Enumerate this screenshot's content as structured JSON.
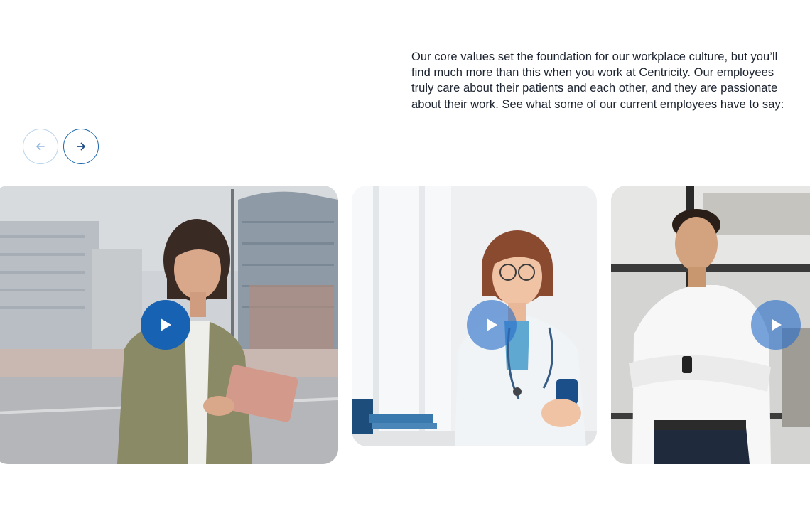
{
  "intro": {
    "text": "Our core values set the foundation for our workplace culture, but you’ll find much more than this when you work at Centricity. Our employees truly care about their patients and each other, and they are passionate about their work. See what some of our current employees have to say:"
  },
  "carousel": {
    "prev_icon": "arrow-left-icon",
    "next_icon": "arrow-right-icon",
    "accent_color": "#1762b3",
    "cards": [
      {
        "icon": "play-icon",
        "photo": "woman-with-tablet-in-city-street"
      },
      {
        "icon": "play-icon",
        "photo": "female-doctor-with-phone-at-desk"
      },
      {
        "icon": "play-icon",
        "photo": "man-in-white-shirt-arms-crossed"
      }
    ]
  }
}
